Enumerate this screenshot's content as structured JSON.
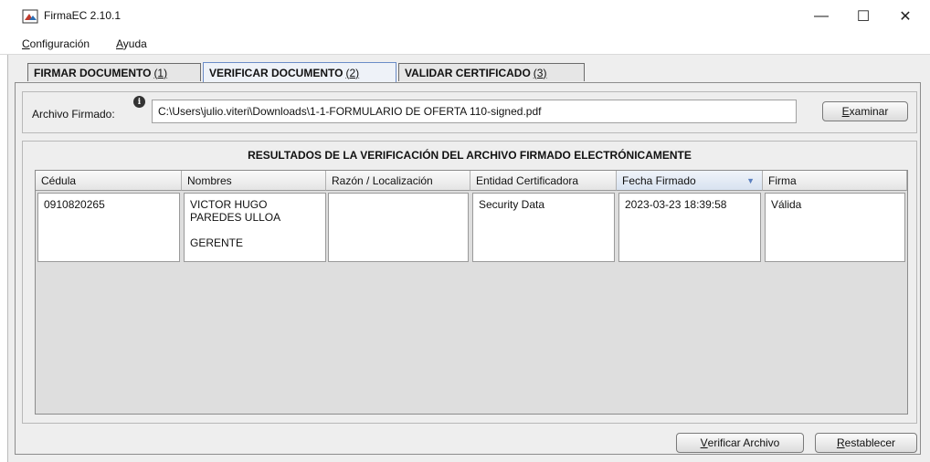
{
  "window": {
    "title": "FirmaEC 2.10.1",
    "minimize_glyph": "—",
    "maximize_glyph": "☐",
    "close_glyph": "✕"
  },
  "menu": {
    "items": [
      {
        "mnemonic": "C",
        "rest": "onfiguración"
      },
      {
        "mnemonic": "A",
        "rest": "yuda"
      }
    ]
  },
  "tabs": [
    {
      "label": "FIRMAR DOCUMENTO",
      "shortcut": "(1)"
    },
    {
      "label": "VERIFICAR DOCUMENTO",
      "shortcut": "(2)"
    },
    {
      "label": "VALIDAR CERTIFICADO",
      "shortcut": "(3)"
    }
  ],
  "file": {
    "label": "Archivo Firmado:",
    "value": "C:\\Users\\julio.viteri\\Downloads\\1-1-FORMULARIO DE OFERTA 110-signed.pdf",
    "examinar": {
      "mnemonic": "E",
      "rest": "xaminar"
    }
  },
  "results": {
    "title": "RESULTADOS DE LA VERIFICACIÓN DEL ARCHIVO FIRMADO ELECTRÓNICAMENTE",
    "columns": [
      "Cédula",
      "Nombres",
      "Razón / Localización",
      "Entidad Certificadora",
      "Fecha Firmado",
      "Firma"
    ],
    "rows": [
      {
        "cedula": "0910820265",
        "nombres_line1": "VICTOR HUGO",
        "nombres_line2": "PAREDES ULLOA",
        "nombres_line3": "GERENTE",
        "razon": "",
        "entidad": "Security Data",
        "fecha": "2023-03-23 18:39:58",
        "firma": "Válida"
      }
    ]
  },
  "buttons": {
    "verificar": {
      "mnemonic": "V",
      "rest": "erificar Archivo"
    },
    "restablecer": {
      "mnemonic": "R",
      "rest": "establecer"
    }
  }
}
